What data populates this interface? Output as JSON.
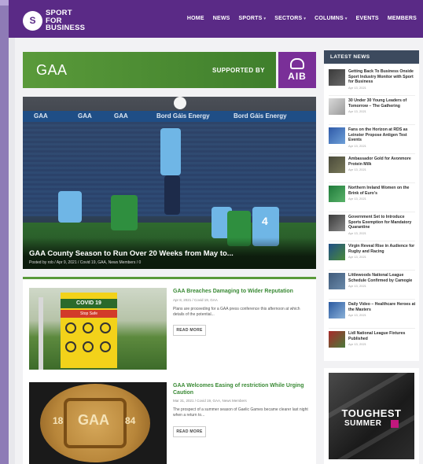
{
  "site": {
    "logo_text_line1": "SPORT",
    "logo_text_line2": "FOR",
    "logo_text_line3": "BUSINESS",
    "brand_color": "#5a2a86"
  },
  "nav": {
    "items": [
      {
        "label": "HOME",
        "dropdown": false
      },
      {
        "label": "NEWS",
        "dropdown": false
      },
      {
        "label": "SPORTS",
        "dropdown": true
      },
      {
        "label": "SECTORS",
        "dropdown": true
      },
      {
        "label": "COLUMNS",
        "dropdown": true
      },
      {
        "label": "EVENTS",
        "dropdown": false
      },
      {
        "label": "MEMBERS",
        "dropdown": false
      }
    ]
  },
  "banner": {
    "title": "GAA",
    "supported_by": "SUPPORTED BY",
    "sponsor": "AIB",
    "green": "#5a9a3a",
    "sponsor_color": "#7a2f98"
  },
  "hero": {
    "title": "GAA County Season to Run Over 20 Weeks from May to...",
    "meta": "Posted by rob / Apr 9, 2021 / Covid 19, GAA, News Members / 0",
    "board_text_1": "GAA",
    "board_text_2": "GAA",
    "board_text_3": "GAA",
    "board_text_4": "Bord Gáis Energy",
    "board_text_5": "Bord Gáis Energy"
  },
  "articles": [
    {
      "title": "GAA Breaches Damaging to Wider Reputation",
      "meta": "Apr 8, 2021 / Covid 19, GAA",
      "excerpt": "Plans are proceeding for a GAA press conference this afternoon at which details of the potential...",
      "read_more": "READ MORE",
      "image_sign": "COVID 19",
      "image_sign_sub": "Stop Safe"
    },
    {
      "title": "GAA Welcomes Easing of restriction While Urging Caution",
      "meta": "Mar 31, 2021 / Covid 19, GAA, News Members",
      "excerpt": "The prospect of a summer season of Gaelic Games became clearer last night when a return to...",
      "read_more": "READ MORE",
      "image_crest_left": "18",
      "image_crest_right": "84",
      "image_crest_mid": "GAA"
    }
  ],
  "sidebar": {
    "heading": "LATEST NEWS",
    "items": [
      {
        "title": "Getting Back To Business Onside Sport Industry Monitor with Sport for Business",
        "date": "Apr 13, 2021"
      },
      {
        "title": "30 Under 30 Young Leaders of Tomorrow – The Gathering",
        "date": "Apr 13, 2021"
      },
      {
        "title": "Fans on the Horizon at RDS as Leinster Propose Antigen Test Events",
        "date": "Apr 13, 2021"
      },
      {
        "title": "Ambassador Gold for Avonmore Protein Milk",
        "date": "Apr 13, 2021"
      },
      {
        "title": "Northern Ireland Women on the Brink of Euro's",
        "date": "Apr 13, 2021"
      },
      {
        "title": "Government Set to Introduce Sports Exemption for Mandatory Quarantine",
        "date": "Apr 13, 2021"
      },
      {
        "title": "Virgin Reveal Rise in Audience for Rugby and Racing",
        "date": "Apr 13, 2021"
      },
      {
        "title": "Littlewoods National League Schedule Confirmed by Camogie",
        "date": "Apr 13, 2021"
      },
      {
        "title": "Daily Video – Healthcare Heroes at the Masters",
        "date": "Apr 13, 2021"
      },
      {
        "title": "Lidl National League Fixtures Published",
        "date": "Apr 13, 2021"
      }
    ]
  },
  "ad": {
    "title": "TOUGHEST",
    "subtitle": "SUMMER"
  },
  "hero_players": {
    "jersey_number": "4"
  }
}
